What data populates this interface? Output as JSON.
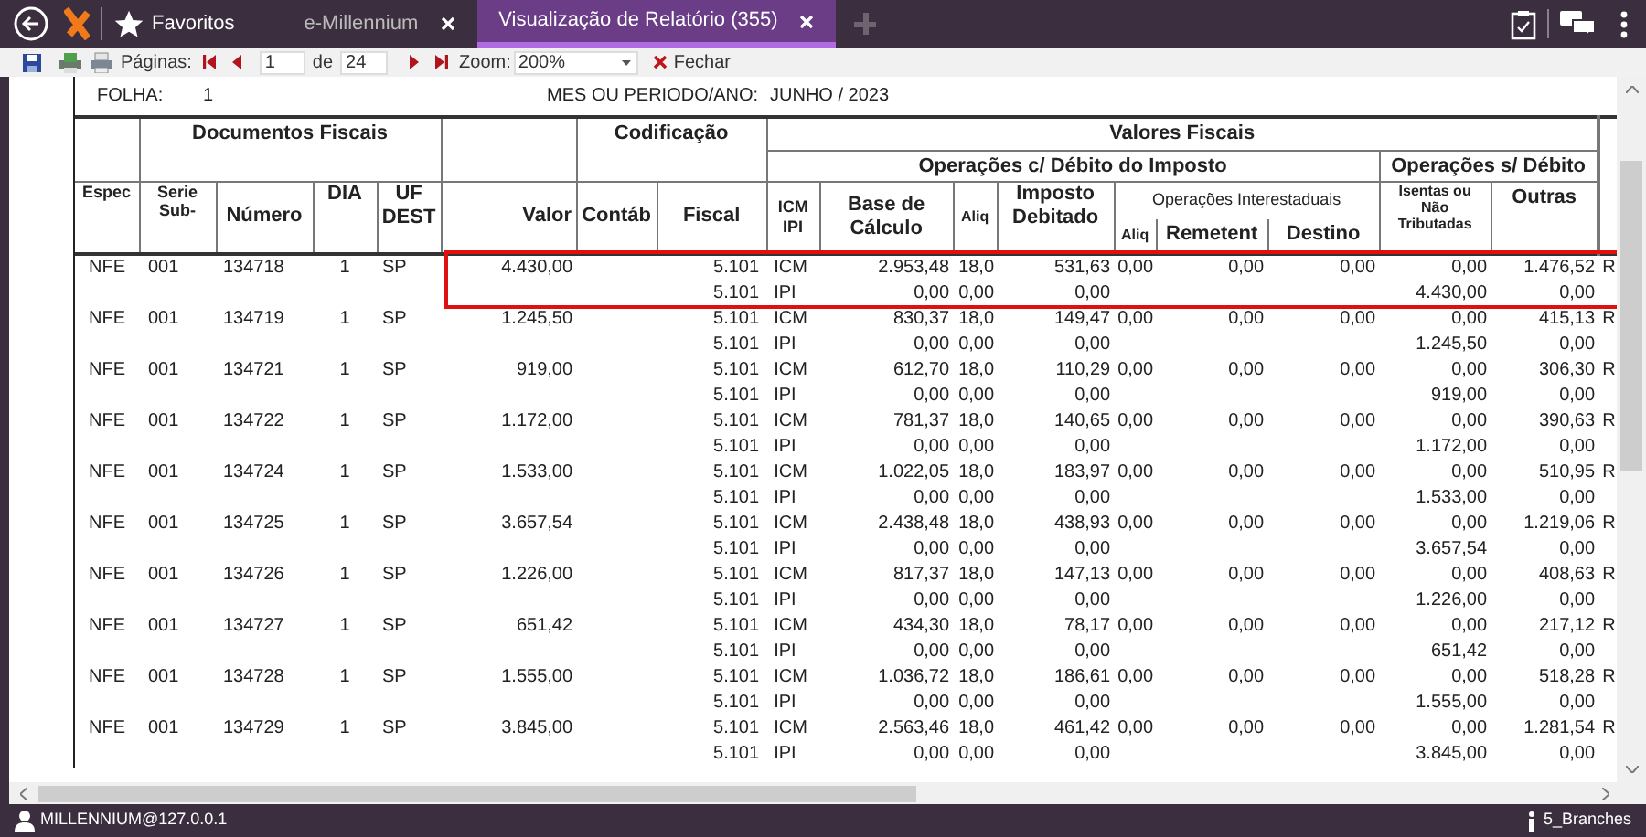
{
  "app_bar": {
    "favorites": "Favoritos",
    "tabs": [
      {
        "label": "e-Millennium",
        "selected": false
      },
      {
        "label": "Visualização de Relatório (355)",
        "selected": true
      }
    ]
  },
  "toolbar": {
    "pages_label": "Páginas:",
    "page": "1",
    "of_label": "de",
    "total": "24",
    "zoom_label": "Zoom:",
    "zoom": "200%",
    "close": "Fechar"
  },
  "report": {
    "sheet_label": "FOLHA:",
    "sheet": "1",
    "period_label": "MES OU PERIODO/ANO:",
    "period": "JUNHO / 2023",
    "groups": {
      "documents": "Documentos Fiscais",
      "coding": "Codificação",
      "values": "Valores Fiscais",
      "with_debit": "Operações c/ Débito do Imposto",
      "without_debit": "Operações s/ Débito",
      "interstate": "Operações Interestaduais"
    },
    "columns": {
      "espec": "Espec",
      "serie": "Serie\nSub-",
      "numero": "Número",
      "dia": "DIA",
      "uf": "UF\nDEST",
      "valor": "Valor",
      "contab": "Contáb",
      "fiscal": "Fiscal",
      "tax": "ICM\nIPI",
      "base": "Base de\nCálculo",
      "aliq": "Aliq",
      "imposto": "Imposto\nDebitado",
      "aliq_inter": "Aliq",
      "remetente": "Remetent",
      "destino": "Destino",
      "isentas": "Isentas ou\nNão\nTributadas",
      "outras": "Outras"
    },
    "documents": [
      {
        "espec": "NFE",
        "serie": "001",
        "numero": "134718",
        "dia": "1",
        "uf": "SP",
        "valor": "4.430,00",
        "highlighted": true,
        "lines": [
          {
            "fiscal": "5.101",
            "tax": "ICM",
            "base": "2.953,48",
            "aliq": "18,0",
            "imposto": "531,63",
            "aliq_inter": "0,00",
            "remetente": "0,00",
            "destino": "0,00",
            "isentas": "0,00",
            "outras": "1.476,52",
            "column_18": "R"
          },
          {
            "fiscal": "5.101",
            "tax": "IPI",
            "base": "0,00",
            "aliq": "0,00",
            "imposto": "0,00",
            "isentas": "4.430,00",
            "outras": "0,00"
          }
        ]
      },
      {
        "espec": "NFE",
        "serie": "001",
        "numero": "134719",
        "dia": "1",
        "uf": "SP",
        "valor": "1.245,50",
        "highlighted": false,
        "lines": [
          {
            "fiscal": "5.101",
            "tax": "ICM",
            "base": "830,37",
            "aliq": "18,0",
            "imposto": "149,47",
            "aliq_inter": "0,00",
            "remetente": "0,00",
            "destino": "0,00",
            "isentas": "0,00",
            "outras": "415,13",
            "column_18": "R"
          },
          {
            "fiscal": "5.101",
            "tax": "IPI",
            "base": "0,00",
            "aliq": "0,00",
            "imposto": "0,00",
            "isentas": "1.245,50",
            "outras": "0,00"
          }
        ]
      },
      {
        "espec": "NFE",
        "serie": "001",
        "numero": "134721",
        "dia": "1",
        "uf": "SP",
        "valor": "919,00",
        "highlighted": false,
        "lines": [
          {
            "fiscal": "5.101",
            "tax": "ICM",
            "base": "612,70",
            "aliq": "18,0",
            "imposto": "110,29",
            "aliq_inter": "0,00",
            "remetente": "0,00",
            "destino": "0,00",
            "isentas": "0,00",
            "outras": "306,30",
            "column_18": "R"
          },
          {
            "fiscal": "5.101",
            "tax": "IPI",
            "base": "0,00",
            "aliq": "0,00",
            "imposto": "0,00",
            "isentas": "919,00",
            "outras": "0,00"
          }
        ]
      },
      {
        "espec": "NFE",
        "serie": "001",
        "numero": "134722",
        "dia": "1",
        "uf": "SP",
        "valor": "1.172,00",
        "highlighted": false,
        "lines": [
          {
            "fiscal": "5.101",
            "tax": "ICM",
            "base": "781,37",
            "aliq": "18,0",
            "imposto": "140,65",
            "aliq_inter": "0,00",
            "remetente": "0,00",
            "destino": "0,00",
            "isentas": "0,00",
            "outras": "390,63",
            "column_18": "R"
          },
          {
            "fiscal": "5.101",
            "tax": "IPI",
            "base": "0,00",
            "aliq": "0,00",
            "imposto": "0,00",
            "isentas": "1.172,00",
            "outras": "0,00"
          }
        ]
      },
      {
        "espec": "NFE",
        "serie": "001",
        "numero": "134724",
        "dia": "1",
        "uf": "SP",
        "valor": "1.533,00",
        "highlighted": false,
        "lines": [
          {
            "fiscal": "5.101",
            "tax": "ICM",
            "base": "1.022,05",
            "aliq": "18,0",
            "imposto": "183,97",
            "aliq_inter": "0,00",
            "remetente": "0,00",
            "destino": "0,00",
            "isentas": "0,00",
            "outras": "510,95",
            "column_18": "R"
          },
          {
            "fiscal": "5.101",
            "tax": "IPI",
            "base": "0,00",
            "aliq": "0,00",
            "imposto": "0,00",
            "isentas": "1.533,00",
            "outras": "0,00"
          }
        ]
      },
      {
        "espec": "NFE",
        "serie": "001",
        "numero": "134725",
        "dia": "1",
        "uf": "SP",
        "valor": "3.657,54",
        "highlighted": false,
        "lines": [
          {
            "fiscal": "5.101",
            "tax": "ICM",
            "base": "2.438,48",
            "aliq": "18,0",
            "imposto": "438,93",
            "aliq_inter": "0,00",
            "remetente": "0,00",
            "destino": "0,00",
            "isentas": "0,00",
            "outras": "1.219,06",
            "column_18": "R"
          },
          {
            "fiscal": "5.101",
            "tax": "IPI",
            "base": "0,00",
            "aliq": "0,00",
            "imposto": "0,00",
            "isentas": "3.657,54",
            "outras": "0,00"
          }
        ]
      },
      {
        "espec": "NFE",
        "serie": "001",
        "numero": "134726",
        "dia": "1",
        "uf": "SP",
        "valor": "1.226,00",
        "highlighted": false,
        "lines": [
          {
            "fiscal": "5.101",
            "tax": "ICM",
            "base": "817,37",
            "aliq": "18,0",
            "imposto": "147,13",
            "aliq_inter": "0,00",
            "remetente": "0,00",
            "destino": "0,00",
            "isentas": "0,00",
            "outras": "408,63",
            "column_18": "R"
          },
          {
            "fiscal": "5.101",
            "tax": "IPI",
            "base": "0,00",
            "aliq": "0,00",
            "imposto": "0,00",
            "isentas": "1.226,00",
            "outras": "0,00"
          }
        ]
      },
      {
        "espec": "NFE",
        "serie": "001",
        "numero": "134727",
        "dia": "1",
        "uf": "SP",
        "valor": "651,42",
        "highlighted": false,
        "lines": [
          {
            "fiscal": "5.101",
            "tax": "ICM",
            "base": "434,30",
            "aliq": "18,0",
            "imposto": "78,17",
            "aliq_inter": "0,00",
            "remetente": "0,00",
            "destino": "0,00",
            "isentas": "0,00",
            "outras": "217,12",
            "column_18": "R"
          },
          {
            "fiscal": "5.101",
            "tax": "IPI",
            "base": "0,00",
            "aliq": "0,00",
            "imposto": "0,00",
            "isentas": "651,42",
            "outras": "0,00"
          }
        ]
      },
      {
        "espec": "NFE",
        "serie": "001",
        "numero": "134728",
        "dia": "1",
        "uf": "SP",
        "valor": "1.555,00",
        "highlighted": false,
        "lines": [
          {
            "fiscal": "5.101",
            "tax": "ICM",
            "base": "1.036,72",
            "aliq": "18,0",
            "imposto": "186,61",
            "aliq_inter": "0,00",
            "remetente": "0,00",
            "destino": "0,00",
            "isentas": "0,00",
            "outras": "518,28",
            "column_18": "R"
          },
          {
            "fiscal": "5.101",
            "tax": "IPI",
            "base": "0,00",
            "aliq": "0,00",
            "imposto": "0,00",
            "isentas": "1.555,00",
            "outras": "0,00"
          }
        ]
      },
      {
        "espec": "NFE",
        "serie": "001",
        "numero": "134729",
        "dia": "1",
        "uf": "SP",
        "valor": "3.845,00",
        "highlighted": false,
        "lines": [
          {
            "fiscal": "5.101",
            "tax": "ICM",
            "base": "2.563,46",
            "aliq": "18,0",
            "imposto": "461,42",
            "aliq_inter": "0,00",
            "remetente": "0,00",
            "destino": "0,00",
            "isentas": "0,00",
            "outras": "1.281,54",
            "column_18": "R"
          },
          {
            "fiscal": "5.101",
            "tax": "IPI",
            "base": "0,00",
            "aliq": "0,00",
            "imposto": "0,00",
            "isentas": "3.845,00",
            "outras": "0,00"
          }
        ]
      }
    ]
  },
  "status_bar": {
    "user": "MILLENNIUM@127.0.0.1",
    "branches": "5_Branches"
  }
}
